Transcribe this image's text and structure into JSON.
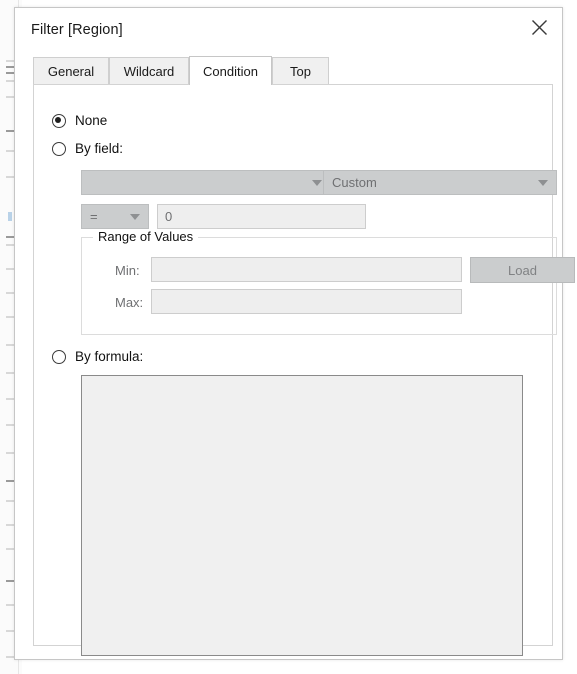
{
  "window": {
    "title": "Filter [Region]",
    "close_icon": "close-icon"
  },
  "tabs": [
    {
      "label": "General",
      "active": false
    },
    {
      "label": "Wildcard",
      "active": false
    },
    {
      "label": "Condition",
      "active": true
    },
    {
      "label": "Top",
      "active": false
    }
  ],
  "condition": {
    "options": [
      {
        "label": "None",
        "selected": true
      },
      {
        "label": "By field:",
        "selected": false
      },
      {
        "label": "By formula:",
        "selected": false
      }
    ],
    "field_dropdown": {
      "value": "",
      "arrow_icon": "chevron-down-icon"
    },
    "aggregate_dropdown": {
      "value": "Custom",
      "arrow_icon": "chevron-down-icon"
    },
    "operator_dropdown": {
      "value": "=",
      "arrow_icon": "chevron-down-icon"
    },
    "value_input": {
      "value": "0"
    },
    "range_group": {
      "title": "Range of Values",
      "min_label": "Min:",
      "min_value": "",
      "max_label": "Max:",
      "max_value": "",
      "load_button": "Load"
    },
    "formula_input": {
      "value": ""
    }
  },
  "colors": {
    "dialog_bg": "#ffffff",
    "disabled_control": "#cbcdce",
    "disabled_input": "#eeeeee",
    "disabled_text": "#6f7072",
    "tab_inactive": "#f0f0f0",
    "border": "#c6c6c6"
  }
}
